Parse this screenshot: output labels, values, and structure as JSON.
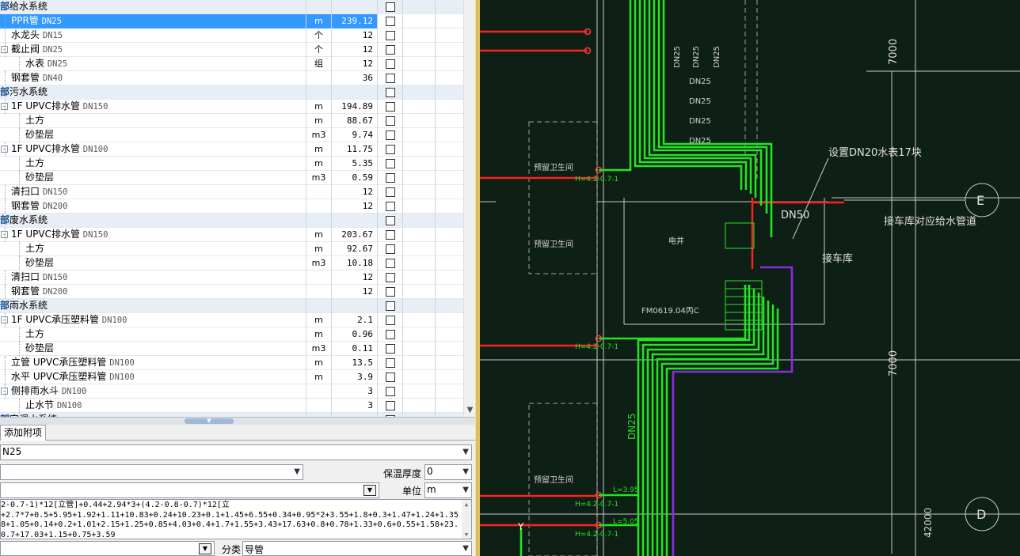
{
  "rows": [
    {
      "type": "group",
      "name": "给水系统",
      "prefix": "部"
    },
    {
      "type": "item",
      "indent": 1,
      "name": "PPR管",
      "spec": "DN25",
      "unit": "m",
      "qty": "239.12",
      "selected": true
    },
    {
      "type": "item",
      "indent": 1,
      "name": "水龙头",
      "spec": "DN15",
      "unit": "个",
      "qty": "12"
    },
    {
      "type": "item",
      "indent": 1,
      "name": "截止阀",
      "spec": "DN25",
      "unit": "个",
      "qty": "12",
      "toggle": "-"
    },
    {
      "type": "item",
      "indent": 2,
      "name": "水表",
      "spec": "DN25",
      "unit": "组",
      "qty": "12"
    },
    {
      "type": "item",
      "indent": 1,
      "name": "钢套管",
      "spec": "DN40",
      "unit": "",
      "qty": "36"
    },
    {
      "type": "group",
      "name": "污水系统",
      "prefix": "部"
    },
    {
      "type": "item",
      "indent": 1,
      "name": "1F UPVC排水管",
      "spec": "DN150",
      "unit": "m",
      "qty": "194.89",
      "toggle": "-"
    },
    {
      "type": "item",
      "indent": 2,
      "name": "土方",
      "spec": "",
      "unit": "m",
      "qty": "88.67"
    },
    {
      "type": "item",
      "indent": 2,
      "name": "砂垫层",
      "spec": "",
      "unit": "m3",
      "qty": "9.74"
    },
    {
      "type": "item",
      "indent": 1,
      "name": "1F UPVC排水管",
      "spec": "DN100",
      "unit": "m",
      "qty": "11.75",
      "toggle": "-"
    },
    {
      "type": "item",
      "indent": 2,
      "name": "土方",
      "spec": "",
      "unit": "m",
      "qty": "5.35"
    },
    {
      "type": "item",
      "indent": 2,
      "name": "砂垫层",
      "spec": "",
      "unit": "m3",
      "qty": "0.59"
    },
    {
      "type": "item",
      "indent": 1,
      "name": "清扫口",
      "spec": "DN150",
      "unit": "",
      "qty": "12"
    },
    {
      "type": "item",
      "indent": 1,
      "name": "钢套管",
      "spec": "DN200",
      "unit": "",
      "qty": "12"
    },
    {
      "type": "group",
      "name": "废水系统",
      "prefix": "部"
    },
    {
      "type": "item",
      "indent": 1,
      "name": "1F UPVC排水管",
      "spec": "DN150",
      "unit": "m",
      "qty": "203.67",
      "toggle": "-"
    },
    {
      "type": "item",
      "indent": 2,
      "name": "土方",
      "spec": "",
      "unit": "m",
      "qty": "92.67"
    },
    {
      "type": "item",
      "indent": 2,
      "name": "砂垫层",
      "spec": "",
      "unit": "m3",
      "qty": "10.18"
    },
    {
      "type": "item",
      "indent": 1,
      "name": "清扫口",
      "spec": "DN150",
      "unit": "",
      "qty": "12"
    },
    {
      "type": "item",
      "indent": 1,
      "name": "钢套管",
      "spec": "DN200",
      "unit": "",
      "qty": "12"
    },
    {
      "type": "group",
      "name": "雨水系统",
      "prefix": "部"
    },
    {
      "type": "item",
      "indent": 1,
      "name": "1F UPVC承压塑料管",
      "spec": "DN100",
      "unit": "m",
      "qty": "2.1",
      "toggle": "-"
    },
    {
      "type": "item",
      "indent": 2,
      "name": "土方",
      "spec": "",
      "unit": "m",
      "qty": "0.96"
    },
    {
      "type": "item",
      "indent": 2,
      "name": "砂垫层",
      "spec": "",
      "unit": "m3",
      "qty": "0.11"
    },
    {
      "type": "item",
      "indent": 1,
      "name": "立管 UPVC承压塑料管",
      "spec": "DN100",
      "unit": "m",
      "qty": "13.5"
    },
    {
      "type": "item",
      "indent": 1,
      "name": "水平 UPVC承压塑料管",
      "spec": "DN100",
      "unit": "m",
      "qty": "3.9"
    },
    {
      "type": "item",
      "indent": 1,
      "name": "侧排雨水斗",
      "spec": "DN100",
      "unit": "",
      "qty": "3",
      "toggle": "-"
    },
    {
      "type": "item",
      "indent": 2,
      "name": "止水节",
      "spec": "DN100",
      "unit": "",
      "qty": "3"
    },
    {
      "type": "group",
      "name": "空调水系统",
      "prefix": "部"
    }
  ],
  "tabs": {
    "add_attachment": "添加附项"
  },
  "form": {
    "name_value": "N25",
    "insulation_label": "保温厚度",
    "insulation_value": "0",
    "unit_label": "单位",
    "unit_value": "m",
    "category_label": "分类",
    "category_value": "导管"
  },
  "formula_lines": [
    "2-0.7-1)*12[立管]+0.44+2.94*3+(4.2-0.8-0.7)*12[立",
    "+2.7*7+0.5+5.95+1.92+1.11+10.83+0.24+10.23+0.1+1.45+6.55+0.34+0.95*2+3.55+1.8+0.3+1.47+1.24+1.35",
    "8+1.05+0.14+0.2+1.01+2.15+1.25+0.85+4.03+0.4+1.7+1.55+3.43+17.63+0.8+0.78+1.33+0.6+0.55+1.58+23.",
    "0.7+17.03+1.15+0.75+3.59"
  ],
  "cad": {
    "labels": {
      "dn25_a": "DN25",
      "dn25_b": "DN25",
      "dn25_c": "DN25",
      "dn25_d": "DN25",
      "dn25_e": "DN25",
      "dn25_f": "DN25",
      "dn25_g": "DN25",
      "meter_note": "设置DN20水表17块",
      "dn50": "DN50",
      "garage_supply": "接车库对应给水管道",
      "garage": "接车库",
      "room_1": "预留卫生间",
      "room_2": "预留卫生间",
      "room_3": "预留卫生间",
      "shaft": "电井",
      "door": "FM0619.04丙C",
      "dim_7000_a": "7000",
      "dim_7000_b": "7000",
      "dim_42000": "42000",
      "axis_e": "E",
      "axis_d": "D",
      "h_label_1": "H=4.2-0.7-1",
      "h_label_2": "H=4.2-0.7-1",
      "h_label_3": "H=4.2-0.7-1",
      "h_label_4": "H=4.2-0.7-1",
      "l_label_1": "L=3.95",
      "l_label_2": "L=5.05",
      "dn25_vert": "DN25",
      "cursor_y": "Y"
    }
  }
}
